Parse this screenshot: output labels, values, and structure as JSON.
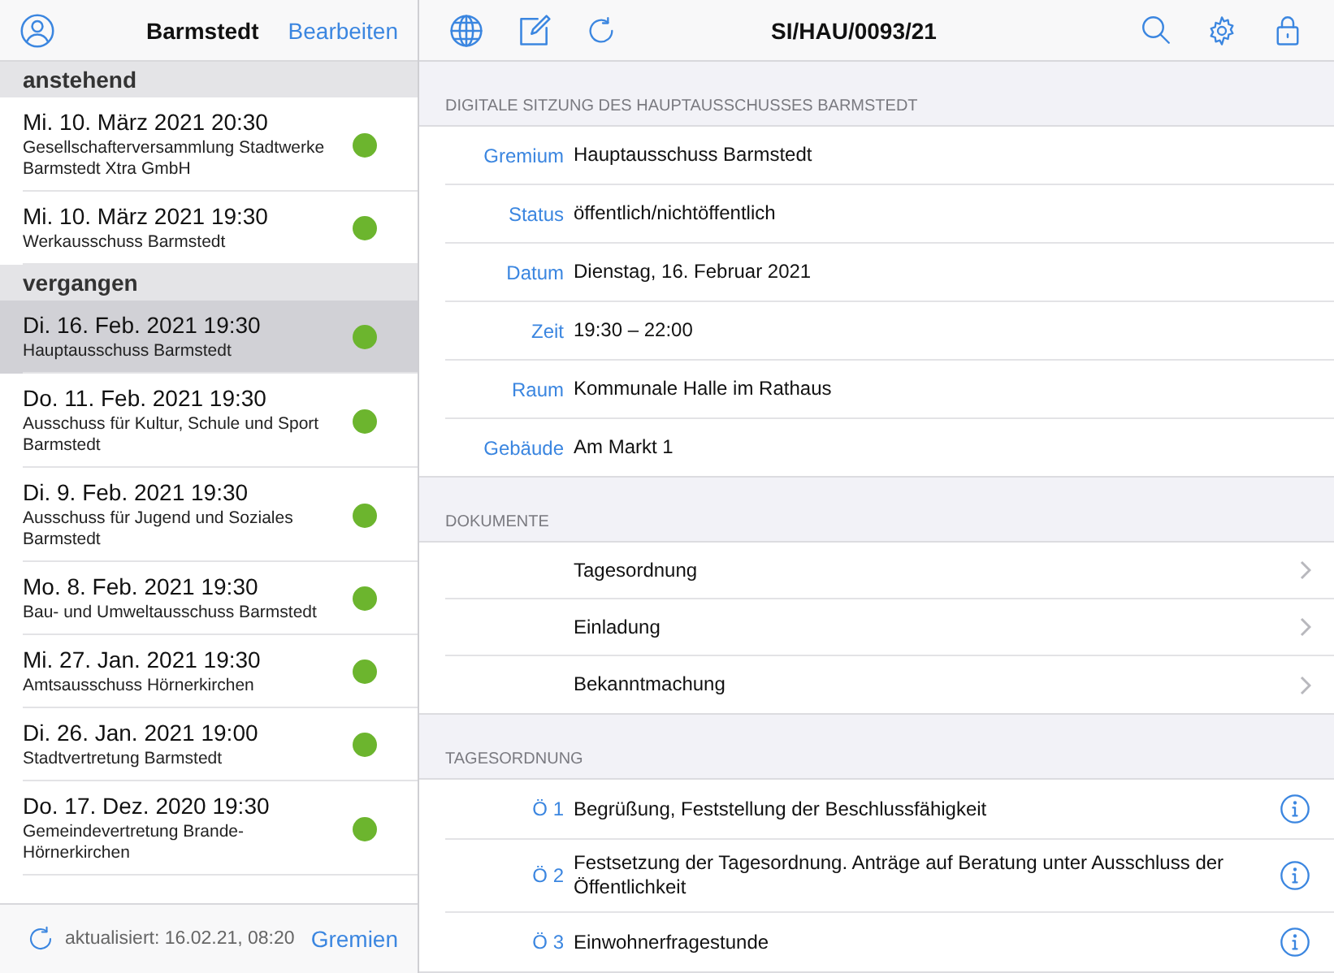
{
  "sidebar": {
    "title": "Barmstedt",
    "edit_button": "Bearbeiten",
    "sections": [
      {
        "title": "anstehend",
        "items": [
          {
            "date": "Mi. 10. März 2021 20:30",
            "name": "Gesellschafterversammlung Stadtwerke Barmstedt Xtra GmbH",
            "color": "#6cb52e",
            "selected": false
          },
          {
            "date": "Mi. 10. März 2021 19:30",
            "name": "Werkausschuss Barmstedt",
            "color": "#6cb52e",
            "selected": false
          }
        ]
      },
      {
        "title": "vergangen",
        "items": [
          {
            "date": "Di. 16. Feb. 2021 19:30",
            "name": "Hauptausschuss Barmstedt",
            "color": "#6cb52e",
            "selected": true
          },
          {
            "date": "Do. 11. Feb. 2021 19:30",
            "name": "Ausschuss für Kultur, Schule und Sport Barmstedt",
            "color": "#6cb52e",
            "selected": false
          },
          {
            "date": "Di. 9. Feb. 2021 19:30",
            "name": "Ausschuss für Jugend und Soziales Barmstedt",
            "color": "#6cb52e",
            "selected": false
          },
          {
            "date": "Mo. 8. Feb. 2021 19:30",
            "name": "Bau- und Umweltausschuss Barmstedt",
            "color": "#6cb52e",
            "selected": false
          },
          {
            "date": "Mi. 27. Jan. 2021 19:30",
            "name": "Amtsausschuss Hörnerkirchen",
            "color": "#6cb52e",
            "selected": false
          },
          {
            "date": "Di. 26. Jan. 2021 19:00",
            "name": "Stadtvertretung Barmstedt",
            "color": "#6cb52e",
            "selected": false
          },
          {
            "date": "Do. 17. Dez. 2020 19:30",
            "name": "Gemeindevertretung Brande-Hörnerkirchen",
            "color": "#6cb52e",
            "selected": false
          }
        ]
      }
    ],
    "footer": {
      "updated": "aktualisiert: 16.02.21, 08:20",
      "link": "Gremien"
    }
  },
  "detail": {
    "title": "SI/HAU/0093/21",
    "meeting": {
      "caption": "DIGITALE SITZUNG DES HAUPTAUSSCHUSSES BARMSTEDT",
      "fields": [
        {
          "label": "Gremium",
          "value": "Hauptausschuss Barmstedt"
        },
        {
          "label": "Status",
          "value": "öffentlich/nichtöffentlich"
        },
        {
          "label": "Datum",
          "value": "Dienstag, 16. Februar 2021"
        },
        {
          "label": "Zeit",
          "value": "19:30 – 22:00"
        },
        {
          "label": "Raum",
          "value": "Kommunale Halle im Rathaus"
        },
        {
          "label": "Gebäude",
          "value": "Am Markt 1"
        }
      ]
    },
    "documents": {
      "caption": "DOKUMENTE",
      "items": [
        "Tagesordnung",
        "Einladung",
        "Bekanntmachung"
      ]
    },
    "agenda": {
      "caption": "TAGESORDNUNG",
      "items": [
        {
          "number": "Ö 1",
          "title": "Begrüßung, Feststellung der Beschlussfähigkeit"
        },
        {
          "number": "Ö 2",
          "title": "Festsetzung der Tagesordnung. Anträge auf Beratung unter Ausschluss der Öffentlichkeit"
        },
        {
          "number": "Ö 3",
          "title": "Einwohnerfragestunde"
        }
      ]
    }
  }
}
